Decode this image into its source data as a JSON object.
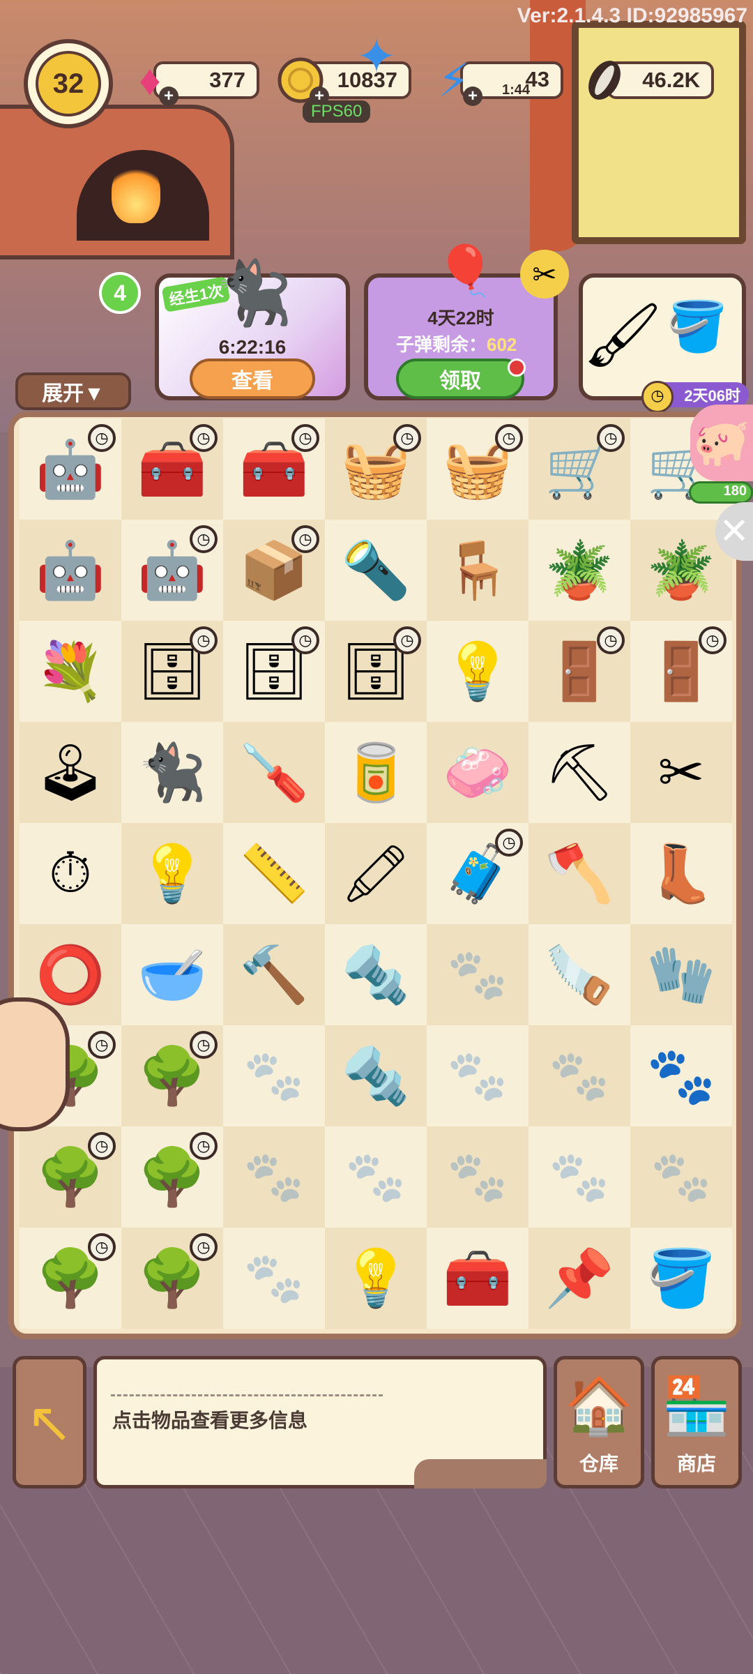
{
  "version_text": "Ver:2.1.4.3 ID:92985967",
  "player": {
    "level": "32"
  },
  "resources": {
    "gems": "377",
    "coins": "10837",
    "energy": "43",
    "energy_timer": "1:44",
    "seeds": "46.2K"
  },
  "fps_label": "FPS60",
  "events": {
    "expand": {
      "count": "4",
      "label": "展开▼"
    },
    "cat_event": {
      "tag": "经生1次",
      "timer": "6:22:16",
      "button": "查看"
    },
    "balloon_event": {
      "timer": "4天22时",
      "ammo_label": "子弹剩余：",
      "ammo_value": "602",
      "button": "领取"
    },
    "brush_event": {
      "timer": "2天06时"
    },
    "pig_progress": "180"
  },
  "grid_icons": [
    [
      "robot-cart-icon",
      "toolbox-icon",
      "open-toolbox-icon",
      "pencil-basket-icon",
      "pencil-basket-icon",
      "wheelbarrow-icon",
      "wheelbarrow-icon"
    ],
    [
      "robot-cart-icon",
      "robot-cart-icon",
      "open-box-icon",
      "flashlight-icon",
      "stool-icon",
      "lightning-pot-icon",
      "lightning-pot-icon"
    ],
    [
      "flower-vase-icon",
      "cabinet-icon",
      "cabinet-icon",
      "cabinet-icon",
      "spotlight-icon",
      "wardrobe-icon",
      "wardrobe-icon"
    ],
    [
      "arcade-machine-icon",
      "black-cat-icon",
      "screwdriver-icon",
      "paint-can-icon",
      "soap-icon",
      "shovel-icon",
      "pruning-shears-icon"
    ],
    [
      "stopwatch-icon",
      "bulb-lamp-icon",
      "level-tool-icon",
      "paint-tubes-icon",
      "treasure-chest-icon",
      "axe-icon",
      "boots-icon"
    ],
    [
      "tape-roll-icon",
      "green-pot-icon",
      "hammer-icon",
      "screws-icon",
      "empty",
      "hand-saw-icon",
      "gloves-icon"
    ],
    [
      "lightning-tree-icon",
      "tree-icon",
      "empty",
      "screw-icon",
      "empty",
      "empty",
      "paw-gloves-icon"
    ],
    [
      "lightning-tree-icon",
      "tree-icon",
      "empty",
      "empty",
      "empty",
      "empty",
      "empty"
    ],
    [
      "lightning-tree-icon",
      "lightning-tree-icon",
      "empty",
      "bulb-icon",
      "toolbox-yellow-icon",
      "nail-icon",
      "bucket-icon"
    ]
  ],
  "info": {
    "hint": "点击物品查看更多信息"
  },
  "bottom": {
    "warehouse_label": "仓库",
    "shop_label": "商店"
  }
}
